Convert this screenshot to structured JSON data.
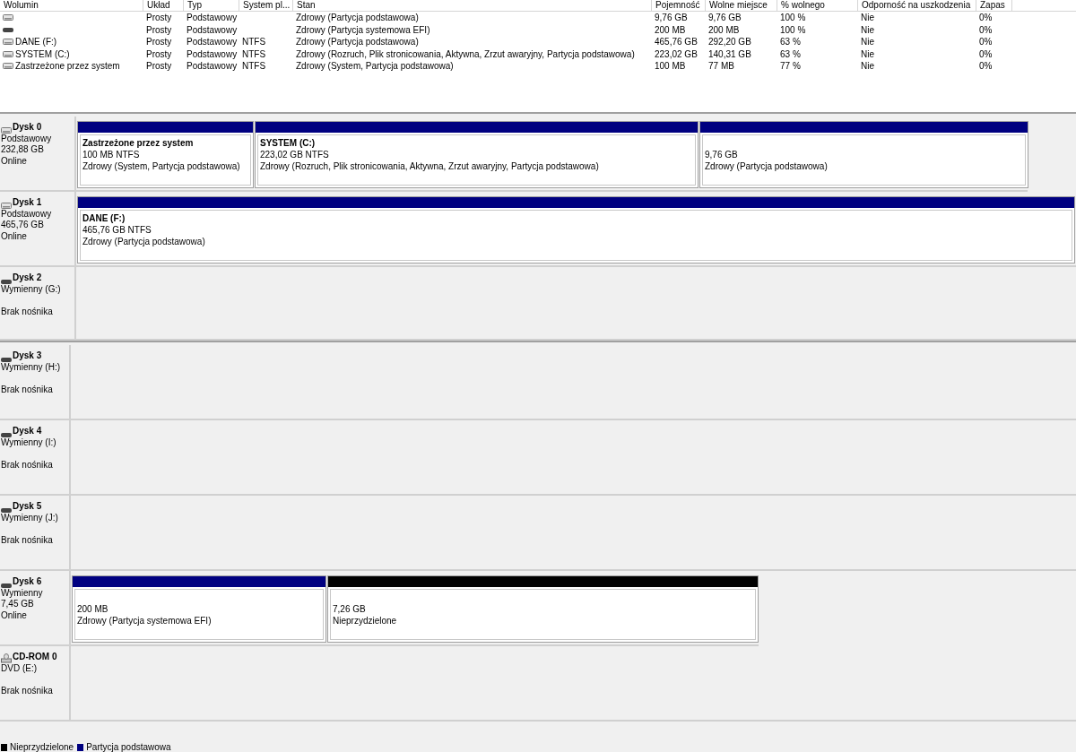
{
  "table": {
    "columns": [
      "Wolumin",
      "Układ",
      "Typ",
      "System pl...",
      "Stan",
      "Pojemność",
      "Wolne miejsce",
      "% wolnego",
      "Odporność na uszkodzenia",
      "Zapas"
    ],
    "rows": [
      {
        "cells": [
          "",
          "Prosty",
          "Podstawowy",
          "",
          "Zdrowy (Partycja podstawowa)",
          "9,76 GB",
          "9,76 GB",
          "100 %",
          "Nie",
          "0%"
        ]
      },
      {
        "cells": [
          "",
          "Prosty",
          "Podstawowy",
          "",
          "Zdrowy (Partycja systemowa EFI)",
          "200 MB",
          "200 MB",
          "100 %",
          "Nie",
          "0%"
        ]
      },
      {
        "cells": [
          "DANE (F:)",
          "Prosty",
          "Podstawowy",
          "NTFS",
          "Zdrowy (Partycja podstawowa)",
          "465,76 GB",
          "292,20 GB",
          "63 %",
          "Nie",
          "0%"
        ]
      },
      {
        "cells": [
          "SYSTEM (C:)",
          "Prosty",
          "Podstawowy",
          "NTFS",
          "Zdrowy (Rozruch, Plik stronicowania, Aktywna, Zrzut awaryjny, Partycja podstawowa)",
          "223,02 GB",
          "140,31 GB",
          "63 %",
          "Nie",
          "0%"
        ]
      },
      {
        "cells": [
          "Zastrzeżone przez system",
          "Prosty",
          "Podstawowy",
          "NTFS",
          "Zdrowy (System, Partycja podstawowa)",
          "100 MB",
          "77 MB",
          "77 %",
          "Nie",
          "0%"
        ]
      }
    ]
  },
  "disks": [
    {
      "name": "Dysk 0",
      "lines": [
        "Podstawowy",
        "232,88 GB",
        "Online"
      ],
      "partitions": [
        {
          "kind": "primary",
          "title": "Zastrzeżone przez system",
          "size": "100 MB NTFS",
          "status": "Zdrowy (System, Partycja podstawowa)"
        },
        {
          "kind": "primary",
          "title": "SYSTEM  (C:)",
          "size": "223,02 GB NTFS",
          "status": "Zdrowy (Rozruch, Plik stronicowania, Aktywna, Zrzut awaryjny, Partycja podstawowa)"
        },
        {
          "kind": "primary",
          "size": "9,76 GB",
          "status": "Zdrowy (Partycja podstawowa)"
        }
      ]
    },
    {
      "name": "Dysk 1",
      "lines": [
        "Podstawowy",
        "465,76 GB",
        "Online"
      ],
      "partitions": [
        {
          "kind": "primary",
          "title": "DANE  (F:)",
          "size": "465,76 GB NTFS",
          "status": "Zdrowy (Partycja podstawowa)"
        }
      ]
    },
    {
      "name": "Dysk 2",
      "lines": [
        "Wymienny (G:)"
      ],
      "media": "Brak nośnika"
    },
    {
      "name": "Dysk 3",
      "lines": [
        "Wymienny (H:)"
      ],
      "media": "Brak nośnika"
    },
    {
      "name": "Dysk 4",
      "lines": [
        "Wymienny (I:)"
      ],
      "media": "Brak nośnika"
    },
    {
      "name": "Dysk 5",
      "lines": [
        "Wymienny (J:)"
      ],
      "media": "Brak nośnika"
    },
    {
      "name": "Dysk 6",
      "lines": [
        "Wymienny",
        "7,45 GB",
        "Online"
      ],
      "partitions": [
        {
          "kind": "primary",
          "size": "200 MB",
          "status": "Zdrowy (Partycja systemowa EFI)"
        },
        {
          "kind": "unallocated",
          "size": "7,26 GB",
          "status": "Nieprzydzielone"
        }
      ]
    },
    {
      "name": "CD-ROM 0",
      "lines": [
        "DVD (E:)"
      ],
      "media": "Brak nośnika"
    }
  ],
  "legend": [
    {
      "label": "Nieprzydzielone",
      "color": "#000000"
    },
    {
      "label": "Partycja podstawowa",
      "color": "#000080"
    }
  ]
}
